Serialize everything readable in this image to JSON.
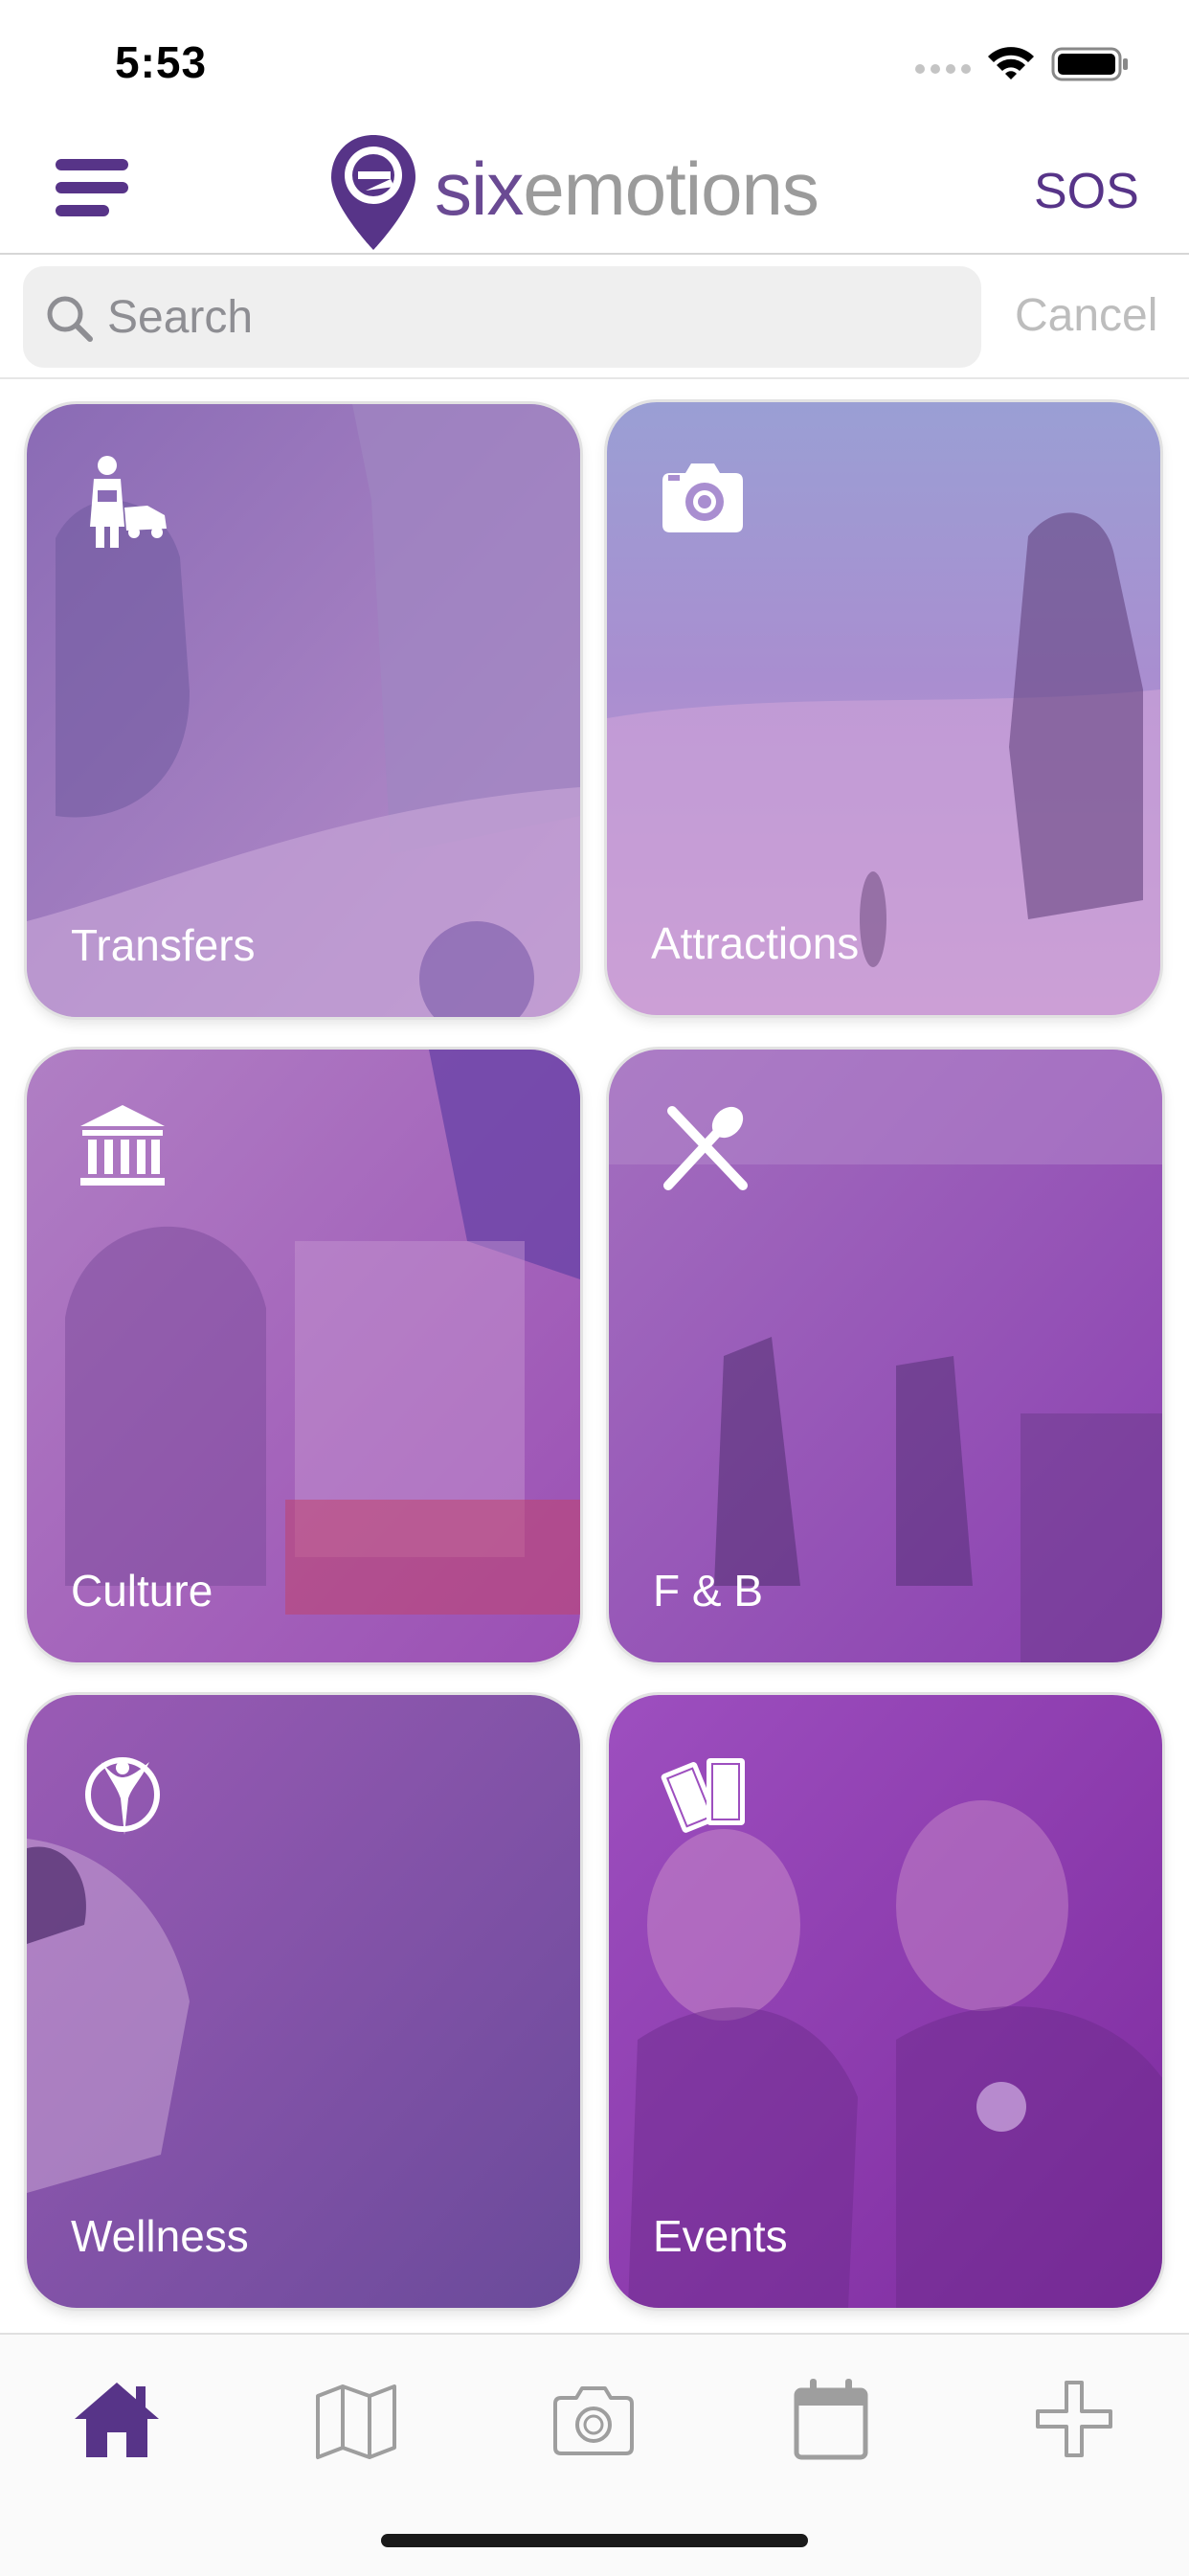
{
  "status_bar": {
    "time": "5:53",
    "icons": [
      "signal-icon",
      "wifi-icon",
      "battery-icon"
    ]
  },
  "header": {
    "logo_six": "six",
    "logo_emotions": "emotions",
    "sos_label": "SOS",
    "menu_icon": "hamburger-menu-icon"
  },
  "search": {
    "placeholder": "Search",
    "value": "",
    "cancel_label": "Cancel"
  },
  "categories": [
    {
      "label": "Transfers",
      "icon": "chauffeur-car-icon"
    },
    {
      "label": "Attractions",
      "icon": "camera-icon"
    },
    {
      "label": "Culture",
      "icon": "museum-icon"
    },
    {
      "label": "F & B",
      "icon": "fork-spoon-icon"
    },
    {
      "label": "Wellness",
      "icon": "wellness-figure-icon"
    },
    {
      "label": "Events",
      "icon": "tickets-icon"
    }
  ],
  "tab_bar": {
    "tabs": [
      {
        "name": "home",
        "icon": "home-icon",
        "active": true
      },
      {
        "name": "map",
        "icon": "map-icon",
        "active": false
      },
      {
        "name": "camera",
        "icon": "camera-icon",
        "active": false
      },
      {
        "name": "calendar",
        "icon": "calendar-icon",
        "active": false
      },
      {
        "name": "add",
        "icon": "plus-icon",
        "active": false
      }
    ]
  },
  "colors": {
    "brand_purple": "#573488",
    "logo_grey": "#9b9b9b",
    "tab_inactive": "#9e9e9e",
    "tile_overlay": "#8a3fb0"
  }
}
